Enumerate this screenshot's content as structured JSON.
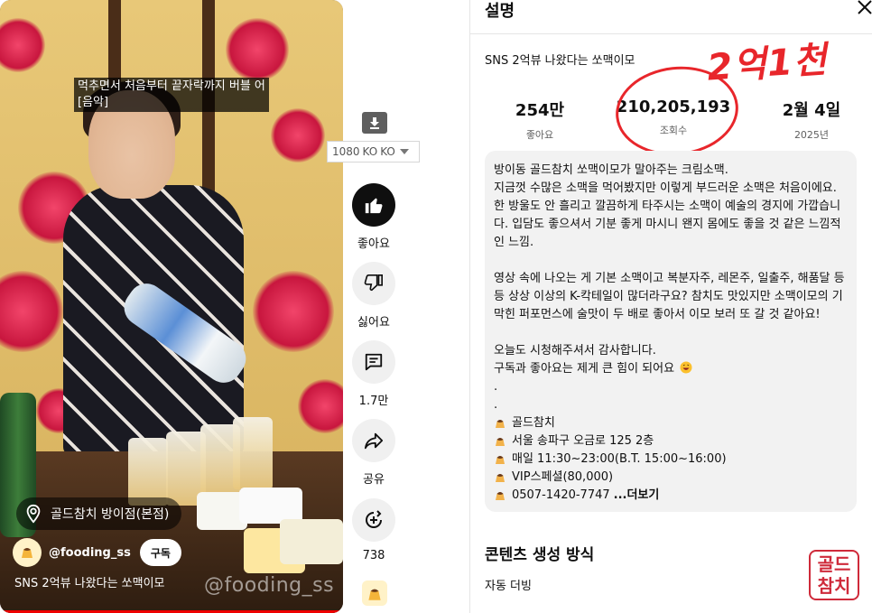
{
  "video": {
    "caption_line1": "먹추면서 처음부터 끝자락까지 버블 어",
    "caption_line2": "[음악]",
    "location_label": "골드참치 방이점(본점)",
    "channel_name": "@fooding_ss",
    "subscribe_label": "구독",
    "title": "SNS 2억뷰 나왔다는 쏘맥이모",
    "watermark": "@fooding_ss"
  },
  "download": {
    "quality_value": "1080",
    "lang1": "KO",
    "lang2": "KO"
  },
  "actions": [
    {
      "name": "like",
      "label": "좋아요",
      "icon": "thumb-up-icon"
    },
    {
      "name": "dislike",
      "label": "싫어요",
      "icon": "thumb-down-icon"
    },
    {
      "name": "comments",
      "label": "1.7만",
      "icon": "comment-icon"
    },
    {
      "name": "share",
      "label": "공유",
      "icon": "share-icon"
    },
    {
      "name": "remix",
      "label": "738",
      "icon": "remix-icon"
    }
  ],
  "description": {
    "heading": "설명",
    "video_title": "SNS 2억뷰 나왔다는 쏘맥이모",
    "handwritten_note": "2억1천",
    "stats": [
      {
        "value": "254만",
        "caption": "좋아요"
      },
      {
        "value": "210,205,193",
        "caption": "조회수"
      },
      {
        "value": "2월 4일",
        "caption": "2025년"
      }
    ],
    "paragraph1": [
      "방이동 골드참치 쏘맥이모가 말아주는 크림소맥.",
      "지금껏 수많은 소맥을 먹어봤지만 이렇게 부드러운 소맥은 처음이에요.",
      "한 방울도 안 흘리고 깔끔하게 타주시는 소맥이 예술의 경지에 가깝습니",
      "다. 입담도 좋으셔서 기분 좋게 마시니 왠지 몸에도 좋을 것 같은 느낌적",
      "인 느낌."
    ],
    "paragraph2": [
      "영상 속에 나오는 게 기본 소맥이고 복분자주, 레몬주, 일출주, 해품달 등",
      "등 상상 이상의 K-칵테일이 많더라구요? 참치도 맛있지만 소맥이모의 기",
      "막힌 퍼포먼스에 술맛이 두 배로 좋아서 이모 보러 또 갈 것 같아요!"
    ],
    "closing1": "오늘도 시청해주셔서 감사합니다.",
    "closing2": "구독과 좋아요는 제게 큰 힘이 되어요",
    "dot": ".",
    "info_lines": [
      "골드참치",
      "서울 송파구 오금로 125 2층",
      "매일 11:30~23:00(B.T. 15:00~16:00)",
      "VIP스페셜(80,000)",
      "0507-1420-7747"
    ],
    "more_label": "...더보기",
    "section_heading": "콘텐츠 생성 방식",
    "section_body": "자동 더빙"
  },
  "seal_text": "골드참치",
  "colors": {
    "accent_red": "#e8262b",
    "text_primary": "#0f0f0f",
    "text_secondary": "#606060",
    "desc_background": "#f2f2f2"
  }
}
